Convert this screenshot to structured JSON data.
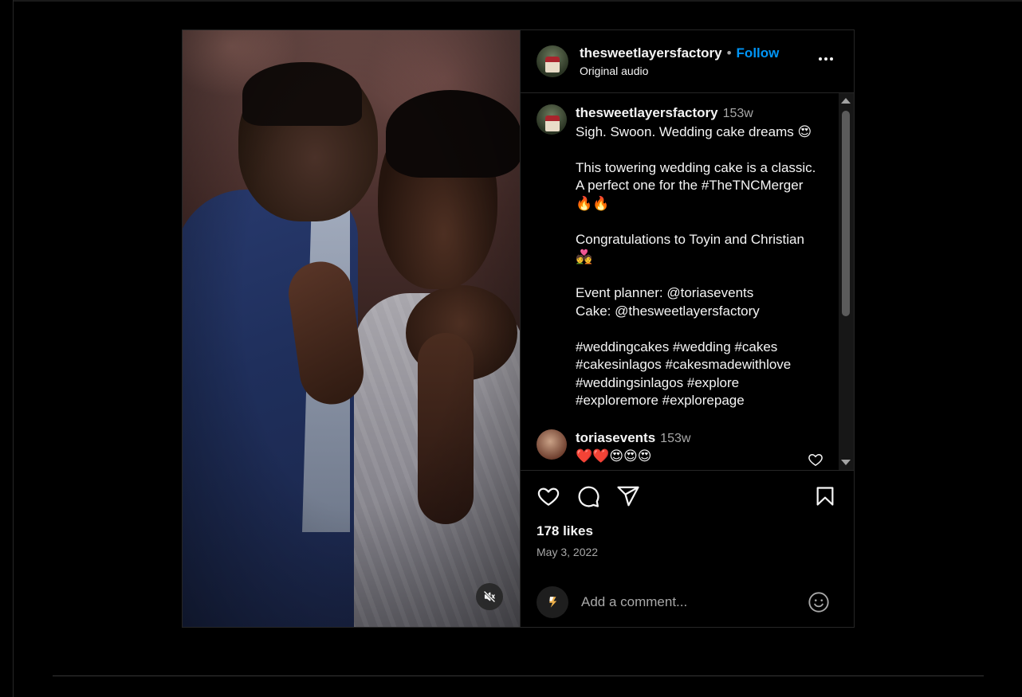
{
  "post": {
    "username": "thesweetlayersfactory",
    "separator": "•",
    "follow_label": "Follow",
    "audio_label": "Original audio",
    "caption": {
      "username": "thesweetlayersfactory",
      "time": "153w",
      "lines": [
        "Sigh. Swoon. Wedding cake dreams 😍",
        "",
        "This towering wedding cake is a classic.",
        "A perfect one for the #TheTNCMerger",
        "🔥🔥",
        "",
        "Congratulations to Toyin and Christian",
        "💑",
        "",
        "Event planner: @toriasevents",
        "Cake: @thesweetlayersfactory",
        "",
        "#weddingcakes #wedding #cakes",
        "#cakesinlagos #cakesmadewithlove",
        "#weddingsinlagos #explore",
        "#exploremore #explorepage"
      ]
    },
    "comments": [
      {
        "username": "toriasevents",
        "time": "153w",
        "text": "❤️❤️😍😍😍"
      }
    ],
    "likes": "178 likes",
    "date": "May 3, 2022",
    "comment_placeholder": "Add a comment..."
  },
  "icons": {
    "more": "more-options-icon",
    "like": "heart-icon",
    "comment": "comment-icon",
    "share": "send-icon",
    "save": "bookmark-icon",
    "mute": "speaker-muted-icon",
    "emoji": "emoji-icon"
  },
  "colors": {
    "background": "#000000",
    "text": "#f5f5f5",
    "secondary_text": "#a8a8a8",
    "follow_blue": "#0095f6",
    "border": "#262626"
  }
}
